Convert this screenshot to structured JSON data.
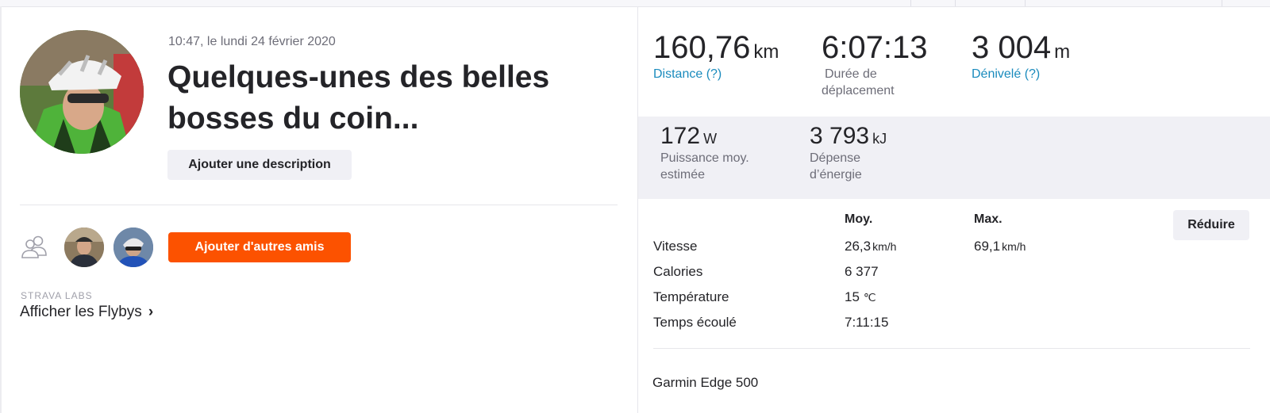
{
  "activity": {
    "timestamp": "10:47, le lundi 24 février 2020",
    "title": "Quelques-unes des belles bosses du coin...",
    "add_description_label": "Ajouter une description"
  },
  "social": {
    "add_friends_label": "Ajouter d'autres amis",
    "labs_label": "STRAVA LABS",
    "flyby_label": "Afficher les Flybys",
    "icons": [
      "people-icon",
      "chevron-right-icon"
    ]
  },
  "stats": {
    "distance": {
      "value": "160,76",
      "unit": "km",
      "label": "Distance (?)"
    },
    "moving_time": {
      "value": "6:07:13",
      "label_line1": "Durée de",
      "label_line2": "déplacement"
    },
    "elevation": {
      "value": "3 004",
      "unit": "m",
      "label": "Dénivelé (?)"
    },
    "power": {
      "value": "172",
      "unit": "W",
      "label_line1": "Puissance moy.",
      "label_line2": "estimée"
    },
    "energy": {
      "value": "3 793",
      "unit": "kJ",
      "label_line1": "Dépense",
      "label_line2": "d’énergie"
    }
  },
  "details": {
    "col_avg": "Moy.",
    "col_max": "Max.",
    "reduce_label": "Réduire",
    "rows": [
      {
        "label": "Vitesse",
        "avg": "26,3",
        "avg_unit": "km/h",
        "max": "69,1",
        "max_unit": "km/h"
      },
      {
        "label": "Calories",
        "avg": "6 377",
        "avg_unit": ""
      },
      {
        "label": "Température",
        "avg": "15",
        "avg_unit": "℃"
      },
      {
        "label": "Temps écoulé",
        "avg": "7:11:15",
        "avg_unit": ""
      }
    ],
    "device": "Garmin Edge 500"
  },
  "colors": {
    "accent_orange": "#fc5200",
    "link_blue": "#1a8bbd",
    "text_dark": "#242428",
    "text_muted": "#6d6d78",
    "panel_gray": "#f0f0f5"
  }
}
